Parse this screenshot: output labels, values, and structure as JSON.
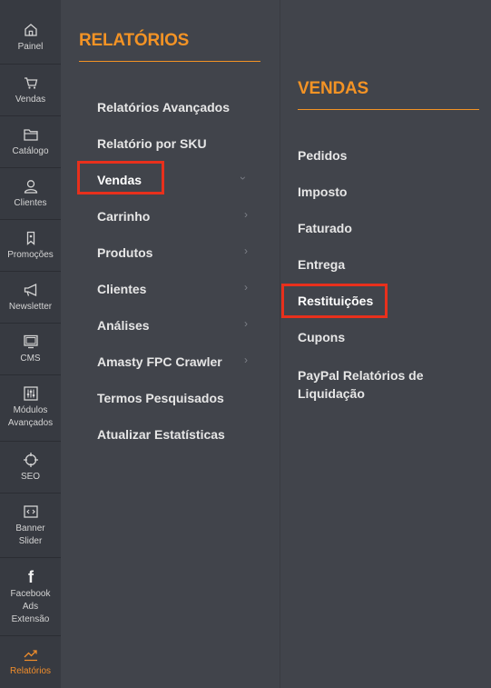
{
  "nav": {
    "items": [
      {
        "key": "painel",
        "label": "Painel",
        "icon": "home-icon"
      },
      {
        "key": "vendas",
        "label": "Vendas",
        "icon": "cart-icon"
      },
      {
        "key": "catalogo",
        "label": "Catálogo",
        "icon": "folder-icon"
      },
      {
        "key": "clientes",
        "label": "Clientes",
        "icon": "user-icon"
      },
      {
        "key": "promocoes",
        "label": "Promoções",
        "icon": "tag-icon"
      },
      {
        "key": "newsletter",
        "label": "Newsletter",
        "icon": "megaphone-icon"
      },
      {
        "key": "cms",
        "label": "CMS",
        "icon": "monitor-icon"
      },
      {
        "key": "modulos",
        "label": "Módulos Avançados",
        "icon": "sliders-icon"
      },
      {
        "key": "seo",
        "label": "SEO",
        "icon": "crosshair-icon"
      },
      {
        "key": "banner",
        "label": "Banner Slider",
        "icon": "code-icon"
      },
      {
        "key": "facebook",
        "label": "Facebook Ads Extensão",
        "icon": "facebook-icon"
      },
      {
        "key": "relatorios",
        "label": "Relatórios",
        "icon": "trending-up-icon"
      }
    ]
  },
  "panel1": {
    "title": "RELATÓRIOS",
    "items": [
      {
        "label": "Relatórios Avançados"
      },
      {
        "label": "Relatório por SKU"
      },
      {
        "label": "Vendas"
      },
      {
        "label": "Carrinho"
      },
      {
        "label": "Produtos"
      },
      {
        "label": "Clientes"
      },
      {
        "label": "Análises"
      },
      {
        "label": "Amasty FPC Crawler"
      },
      {
        "label": "Termos Pesquisados"
      },
      {
        "label": "Atualizar Estatísticas"
      }
    ]
  },
  "panel2": {
    "title": "VENDAS",
    "items": [
      {
        "label": "Pedidos"
      },
      {
        "label": "Imposto"
      },
      {
        "label": "Faturado"
      },
      {
        "label": "Entrega"
      },
      {
        "label": "Restituições"
      },
      {
        "label": "Cupons"
      },
      {
        "label": "PayPal Relatórios de Liquidação"
      }
    ]
  },
  "colors": {
    "accent": "#f39325",
    "highlight": "#e8301c",
    "nav_bg": "#373a41",
    "panel_bg": "#41444b"
  }
}
